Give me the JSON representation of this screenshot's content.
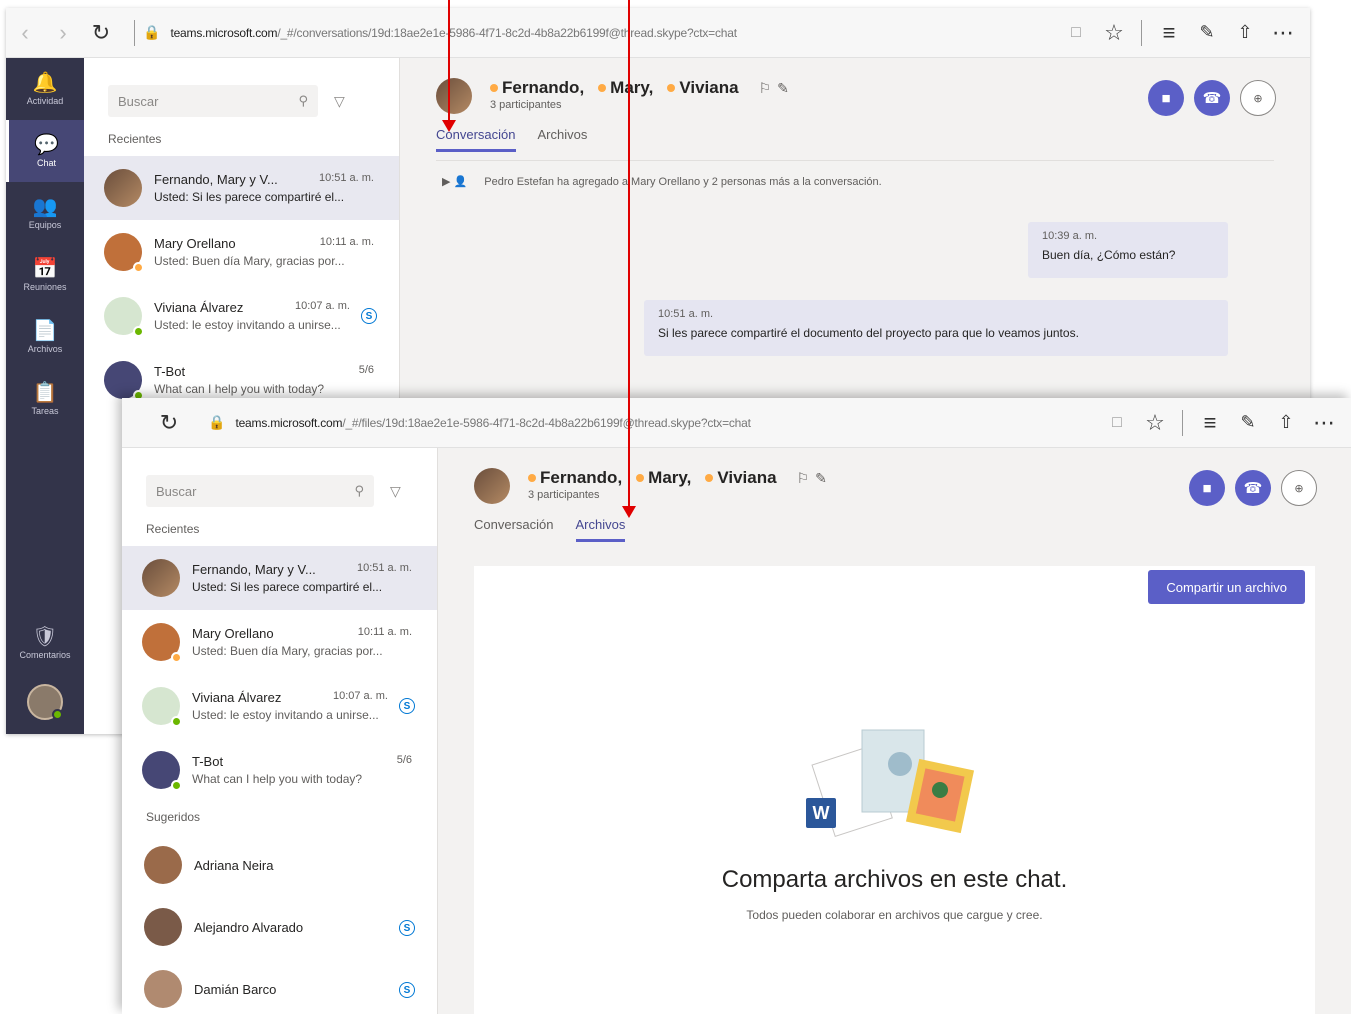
{
  "browser": {
    "url_host": "teams.microsoft.com",
    "url_path_1": "/_#/conversations/19d:18ae2e1e-5986-4f71-8c2d-4b8a22b6199f@thread.skype?ctx=chat",
    "url_path_2": "/_#/files/19d:18ae2e1e-5986-4f71-8c2d-4b8a22b6199f@thread.skype?ctx=chat"
  },
  "rail": {
    "items": [
      {
        "label": "Actividad",
        "icon": "🔔"
      },
      {
        "label": "Chat",
        "icon": "💬"
      },
      {
        "label": "Equipos",
        "icon": "👥"
      },
      {
        "label": "Reuniones",
        "icon": "📅"
      },
      {
        "label": "Archivos",
        "icon": "📄"
      },
      {
        "label": "Tareas",
        "icon": "📋"
      }
    ],
    "comments_label": "Comentarios",
    "comments_icon": "🛡"
  },
  "list": {
    "search_placeholder": "Buscar",
    "recent_label": "Recientes",
    "suggested_label": "Sugeridos",
    "chats": [
      {
        "name": "Fernando, Mary y V...",
        "time": "10:51 a. m.",
        "preview_1": "Usted: Si les parece compartiré el...",
        "preview_2": "Usted: Si les parece compartiré el..."
      },
      {
        "name": "Mary Orellano",
        "time": "10:11 a. m.",
        "preview_1": "Usted: Buen día Mary, gracias por...",
        "preview_2": "Usted: Buen día Mary, gracias por..."
      },
      {
        "name": "Viviana Álvarez",
        "time": "10:07 a. m.",
        "preview_1": "Usted: le estoy invitando a unirse...",
        "preview_2": "Usted: le estoy invitando a unirse..."
      },
      {
        "name": "T-Bot",
        "time": "5/6",
        "preview_1": "What can I help you with today?",
        "preview_2": "What can I help you with today?"
      }
    ],
    "suggested": [
      {
        "name": "Adriana Neira"
      },
      {
        "name": "Alejandro Alvarado"
      },
      {
        "name": "Damián Barco"
      }
    ]
  },
  "header": {
    "participants": [
      "Fernando,",
      "Mary,",
      "Viviana"
    ],
    "sub": "3 participantes"
  },
  "tabs": {
    "conversation": "Conversación",
    "files": "Archivos"
  },
  "conversation": {
    "event": "Pedro Estefan ha agregado a Mary Orellano y 2 personas más a la conversación.",
    "messages": [
      {
        "time": "10:39 a. m.",
        "text": "Buen día, ¿Cómo están?"
      },
      {
        "time": "10:51 a. m.",
        "text": "Si les parece compartiré el documento del proyecto para que lo veamos juntos."
      }
    ]
  },
  "files": {
    "share_button": "Compartir un archivo",
    "title": "Comparta archivos en este chat.",
    "subtitle": "Todos pueden colaborar en archivos que cargue y cree."
  },
  "colors": {
    "accent": "#5b5fc7",
    "rail": "#33344a",
    "annotation": "#e00000"
  }
}
